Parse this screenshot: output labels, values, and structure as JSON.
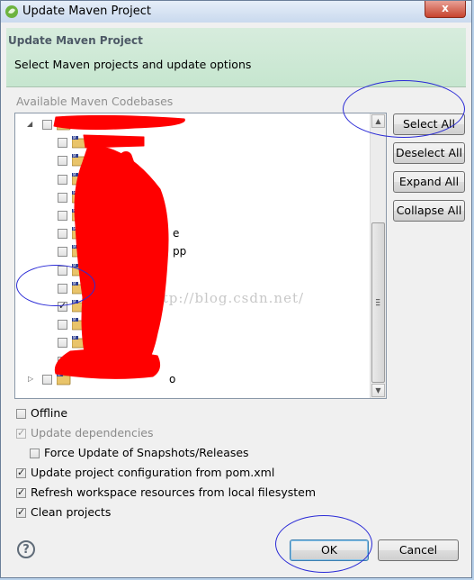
{
  "window": {
    "title": "Update Maven Project",
    "close_glyph": "x"
  },
  "header": {
    "title": "Update Maven Project",
    "message": "Select Maven projects and update options"
  },
  "codebases": {
    "label": "Available Maven Codebases"
  },
  "tree": {
    "visible_label_fragments": [
      {
        "text": "e",
        "row": 6
      },
      {
        "text": "pp",
        "row": 7
      },
      {
        "text": "o",
        "row": 14
      }
    ],
    "checked_row": 10,
    "root_expanded_glyph": "◢",
    "root_collapsed_glyph": "▷"
  },
  "side_buttons": {
    "select_all": "Select All",
    "deselect_all": "Deselect All",
    "expand_all": "Expand All",
    "collapse_all": "Collapse All"
  },
  "options": [
    {
      "key": "offline",
      "label": "Offline",
      "checked": false,
      "disabled": false
    },
    {
      "key": "update_dependencies",
      "label": "Update dependencies",
      "checked": true,
      "disabled": true
    },
    {
      "key": "force_update",
      "label": "Force Update of Snapshots/Releases",
      "checked": false,
      "disabled": false
    },
    {
      "key": "update_config",
      "label": "Update project configuration from pom.xml",
      "checked": true,
      "disabled": false
    },
    {
      "key": "refresh_workspace",
      "label": "Refresh workspace resources from local filesystem",
      "checked": true,
      "disabled": false
    },
    {
      "key": "clean_projects",
      "label": "Clean projects",
      "checked": true,
      "disabled": false
    }
  ],
  "footer": {
    "ok": "OK",
    "cancel": "Cancel",
    "help_glyph": "?"
  },
  "watermark": "http://blog.csdn.net/",
  "colors": {
    "scribble": "#ff0000",
    "annotation_ellipse": "#2b2bd6",
    "header_bg": "#c6e6cf",
    "title_bar": "#c9d9ee"
  },
  "icons": [
    "app-icon",
    "close-icon",
    "maven-project-icon",
    "help-icon",
    "scroll-up-arrow-icon",
    "scroll-down-arrow-icon"
  ]
}
